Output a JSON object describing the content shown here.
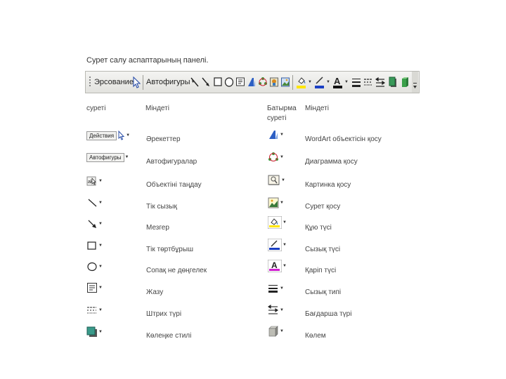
{
  "title": "Сурет салу аспаптарының панелі.",
  "toolbar": {
    "draw_label": "Эрсование",
    "autoshapes_label": "Автофигуры"
  },
  "headers": {
    "left_icon": "суреті",
    "left_task": "Міндеті",
    "right_icon": "Батырма суреті",
    "right_task": "Міндеті"
  },
  "rows": [
    {
      "left_icon_text": "Действия",
      "left": "Әрекеттер",
      "right": "WordArt объектісін қосу",
      "left_icon": "actions-menu-icon",
      "right_icon": "wordart-icon"
    },
    {
      "left_icon_text": "Автофигуры",
      "left": "Автофигуралар",
      "right": "Диаграмма қосу",
      "left_icon": "autoshapes-menu-icon",
      "right_icon": "diagram-icon"
    },
    {
      "left": "Объектіні таңдау",
      "right": "Картинка қосу",
      "left_icon": "select-objects-icon",
      "right_icon": "clipart-icon"
    },
    {
      "left": "Тік сызық",
      "right": "Сурет қосу",
      "left_icon": "line-icon",
      "right_icon": "picture-icon"
    },
    {
      "left": "Мезгер",
      "right": "Құю түсі",
      "left_icon": "arrow-icon",
      "right_icon": "fill-color-icon"
    },
    {
      "left": "Тік төртбұрыш",
      "right": "Сызық түсі",
      "left_icon": "rectangle-icon",
      "right_icon": "line-color-icon"
    },
    {
      "left": "Сопақ не дөңгелек",
      "right": "Қаріп түсі",
      "left_icon": "oval-icon",
      "right_icon": "font-color-icon"
    },
    {
      "left": "Жазу",
      "right": "Сызық типі",
      "left_icon": "textbox-icon",
      "right_icon": "line-style-icon"
    },
    {
      "left": "Штрих түрі",
      "right": "Бағдарша түрі",
      "left_icon": "dash-style-icon",
      "right_icon": "arrow-style-icon"
    },
    {
      "left": "Көлеңке стилі",
      "right": "Көлем",
      "left_icon": "shadow-style-icon",
      "right_icon": "3d-style-icon"
    }
  ]
}
